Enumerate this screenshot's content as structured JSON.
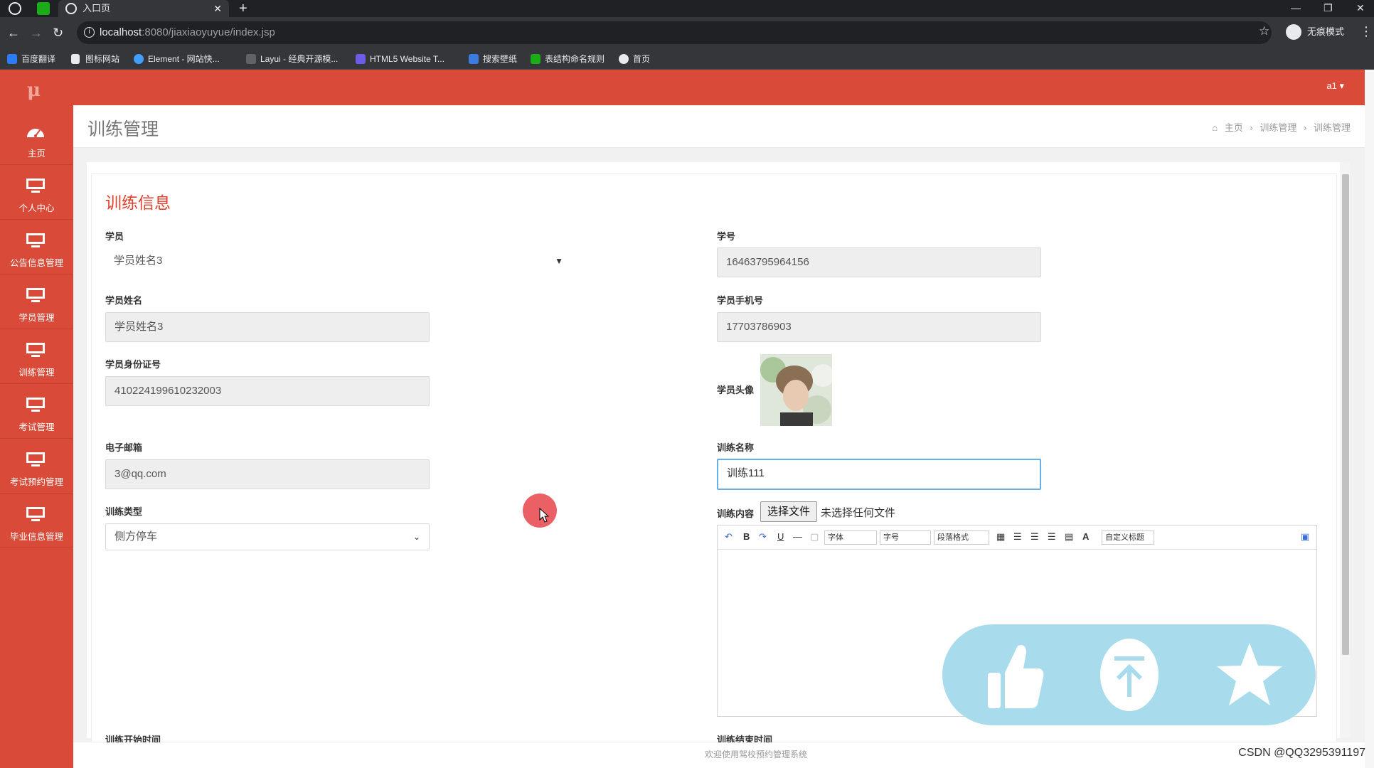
{
  "browser": {
    "tab_title": "入口页",
    "url_host": "localhost",
    "url_path": ":8080/jiaxiaoyuyue/index.jsp",
    "profile_label": "无痕模式",
    "bookmarks": [
      "百度翻译",
      "图标网站",
      "Element - 网站快...",
      "Layui - 经典开源模...",
      "HTML5 Website T...",
      "搜索壁纸",
      "表结构命名规则",
      "首页"
    ]
  },
  "app": {
    "user_menu": "a1 ▾",
    "sidebar": [
      {
        "label": "主页"
      },
      {
        "label": "个人中心"
      },
      {
        "label": "公告信息管理"
      },
      {
        "label": "学员管理"
      },
      {
        "label": "训练管理"
      },
      {
        "label": "考试管理"
      },
      {
        "label": "考试预约管理"
      },
      {
        "label": "毕业信息管理"
      }
    ],
    "page_title": "训练管理",
    "breadcrumb": {
      "home": "主页",
      "sep": "›",
      "level1": "训练管理",
      "level2": "训练管理"
    }
  },
  "form": {
    "section_title": "训练信息",
    "student_label": "学员",
    "student_value": "学员姓名3",
    "student_no_label": "学号",
    "student_no_value": "16463795964156",
    "name_label": "学员姓名",
    "name_value": "学员姓名3",
    "phone_label": "学员手机号",
    "phone_value": "17703786903",
    "idcard_label": "学员身份证号",
    "idcard_value": "410224199610232003",
    "avatar_label": "学员头像",
    "email_label": "电子邮箱",
    "email_value": "3@qq.com",
    "training_name_label": "训练名称",
    "training_name_value": "训练111",
    "training_type_label": "训练类型",
    "training_type_value": "侧方停车",
    "content_label": "训练内容",
    "file_button": "选择文件",
    "file_status": "未选择任何文件",
    "start_time_label": "训练开始时间",
    "end_time_label": "训练结束时间"
  },
  "editor_toolbar": {
    "font": "字体",
    "size": "字号",
    "paragraph": "段落格式",
    "custom_title": "自定义标题",
    "bold": "B",
    "underline": "U",
    "font_color": "A"
  },
  "footer": {
    "text": "欢迎使用驾校预约管理系统",
    "watermark": "CSDN @QQ3295391197"
  },
  "colors": {
    "brand_red": "#d94a38",
    "section_red": "#e0402e",
    "reaction_blue": "#a8dcec"
  }
}
